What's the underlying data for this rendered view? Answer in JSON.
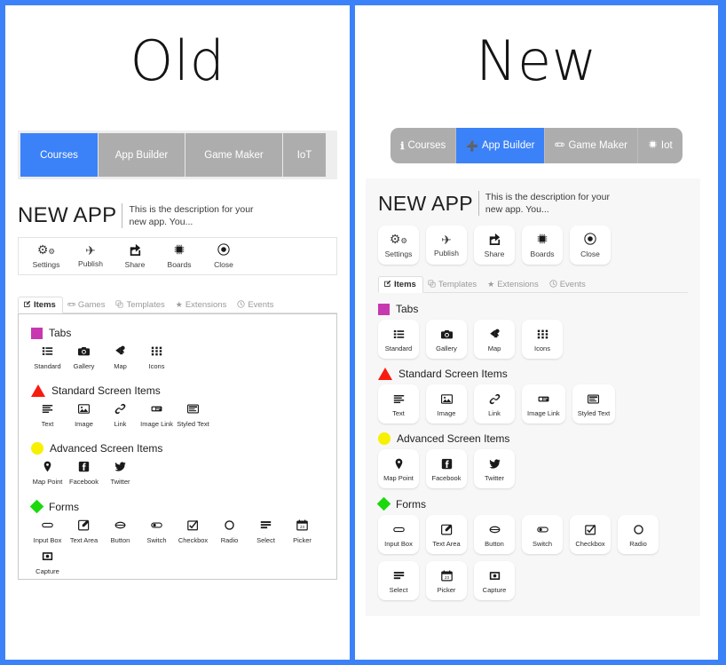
{
  "accent_blue": "#3b82f8",
  "inactive_gray": "#adadad",
  "panel_bg": "#f7f7f8",
  "panels": {
    "old": {
      "title": "Old",
      "nav": {
        "tabs": [
          {
            "label": "Courses",
            "active": true
          },
          {
            "label": "App Builder",
            "active": false
          },
          {
            "label": "Game Maker",
            "active": false
          },
          {
            "label": "IoT",
            "active": false
          }
        ]
      },
      "app": {
        "name": "NEW APP",
        "description": "This is the description for your new app. You..."
      },
      "toolbar": [
        {
          "label": "Settings",
          "icon": "gears-icon"
        },
        {
          "label": "Publish",
          "icon": "plane-icon"
        },
        {
          "label": "Share",
          "icon": "share-icon"
        },
        {
          "label": "Boards",
          "icon": "chip-icon"
        },
        {
          "label": "Close",
          "icon": "close-circle-icon"
        }
      ],
      "subtabs": [
        {
          "label": "Items",
          "icon": "edit-icon",
          "active": true
        },
        {
          "label": "Games",
          "icon": "gamepad-icon",
          "active": false
        },
        {
          "label": "Templates",
          "icon": "clone-icon",
          "active": false
        },
        {
          "label": "Extensions",
          "icon": "star-icon",
          "active": false
        },
        {
          "label": "Events",
          "icon": "clock-icon",
          "active": false
        }
      ],
      "categories": [
        {
          "title": "Tabs",
          "marker": "square",
          "marker_color": "#c738b0",
          "items": [
            {
              "label": "Standard",
              "icon": "list-icon"
            },
            {
              "label": "Gallery",
              "icon": "camera-icon"
            },
            {
              "label": "Map",
              "icon": "map-marker-icon"
            },
            {
              "label": "Icons",
              "icon": "grid-icon"
            }
          ]
        },
        {
          "title": "Standard Screen Items",
          "marker": "triangle",
          "marker_color": "#f81b0f",
          "items": [
            {
              "label": "Text",
              "icon": "text-lines-icon"
            },
            {
              "label": "Image",
              "icon": "image-icon"
            },
            {
              "label": "Link",
              "icon": "link-icon"
            },
            {
              "label": "Image Link",
              "icon": "image-link-icon"
            },
            {
              "label": "Styled Text",
              "icon": "styled-text-icon"
            }
          ]
        },
        {
          "title": "Advanced Screen Items",
          "marker": "circle",
          "marker_color": "#f7f000",
          "items": [
            {
              "label": "Map Point",
              "icon": "pin-icon"
            },
            {
              "label": "Facebook",
              "icon": "facebook-icon"
            },
            {
              "label": "Twitter",
              "icon": "twitter-icon"
            }
          ]
        },
        {
          "title": "Forms",
          "marker": "diamond",
          "marker_color": "#1bd90c",
          "items": [
            {
              "label": "Input Box",
              "icon": "input-box-icon"
            },
            {
              "label": "Text Area",
              "icon": "text-area-icon"
            },
            {
              "label": "Button",
              "icon": "button-icon"
            },
            {
              "label": "Switch",
              "icon": "switch-icon"
            },
            {
              "label": "Checkbox",
              "icon": "checkbox-icon"
            },
            {
              "label": "Radio",
              "icon": "radio-icon"
            },
            {
              "label": "Select",
              "icon": "select-icon"
            },
            {
              "label": "Picker",
              "icon": "calendar-icon"
            },
            {
              "label": "Capture",
              "icon": "capture-icon"
            }
          ]
        }
      ]
    },
    "new": {
      "title": "New",
      "nav": {
        "tabs": [
          {
            "label": "Courses",
            "icon": "info-icon",
            "active": false
          },
          {
            "label": "App Builder",
            "icon": "plus-icon",
            "active": true
          },
          {
            "label": "Game Maker",
            "icon": "gamepad-icon",
            "active": false
          },
          {
            "label": "Iot",
            "icon": "chip-icon",
            "active": false
          }
        ]
      },
      "app": {
        "name": "NEW APP",
        "description": "This is the description for your new app. You..."
      },
      "toolbar": [
        {
          "label": "Settings",
          "icon": "gears-icon"
        },
        {
          "label": "Publish",
          "icon": "plane-icon"
        },
        {
          "label": "Share",
          "icon": "share-icon"
        },
        {
          "label": "Boards",
          "icon": "chip-icon"
        },
        {
          "label": "Close",
          "icon": "close-circle-icon"
        }
      ],
      "subtabs": [
        {
          "label": "Items",
          "icon": "edit-icon",
          "active": true
        },
        {
          "label": "Templates",
          "icon": "clone-icon",
          "active": false
        },
        {
          "label": "Extensions",
          "icon": "star-icon",
          "active": false
        },
        {
          "label": "Events",
          "icon": "clock-icon",
          "active": false
        }
      ],
      "categories": [
        {
          "title": "Tabs",
          "marker": "square",
          "marker_color": "#c738b0",
          "items": [
            {
              "label": "Standard",
              "icon": "list-icon"
            },
            {
              "label": "Gallery",
              "icon": "camera-icon"
            },
            {
              "label": "Map",
              "icon": "map-marker-icon"
            },
            {
              "label": "Icons",
              "icon": "grid-icon"
            }
          ]
        },
        {
          "title": "Standard Screen Items",
          "marker": "triangle",
          "marker_color": "#f81b0f",
          "items": [
            {
              "label": "Text",
              "icon": "text-lines-icon"
            },
            {
              "label": "Image",
              "icon": "image-icon"
            },
            {
              "label": "Link",
              "icon": "link-icon"
            },
            {
              "label": "Image Link",
              "icon": "image-link-icon"
            },
            {
              "label": "Styled Text",
              "icon": "styled-text-icon"
            }
          ]
        },
        {
          "title": "Advanced Screen Items",
          "marker": "circle",
          "marker_color": "#f7f000",
          "items": [
            {
              "label": "Map Point",
              "icon": "pin-icon"
            },
            {
              "label": "Facebook",
              "icon": "facebook-icon"
            },
            {
              "label": "Twitter",
              "icon": "twitter-icon"
            }
          ]
        },
        {
          "title": "Forms",
          "marker": "diamond",
          "marker_color": "#1bd90c",
          "items": [
            {
              "label": "Input Box",
              "icon": "input-box-icon"
            },
            {
              "label": "Text Area",
              "icon": "text-area-icon"
            },
            {
              "label": "Button",
              "icon": "button-icon"
            },
            {
              "label": "Switch",
              "icon": "switch-icon"
            },
            {
              "label": "Checkbox",
              "icon": "checkbox-icon"
            },
            {
              "label": "Radio",
              "icon": "radio-icon"
            },
            {
              "label": "Select",
              "icon": "select-icon"
            },
            {
              "label": "Picker",
              "icon": "calendar-icon"
            },
            {
              "label": "Capture",
              "icon": "capture-icon"
            }
          ]
        }
      ]
    }
  }
}
